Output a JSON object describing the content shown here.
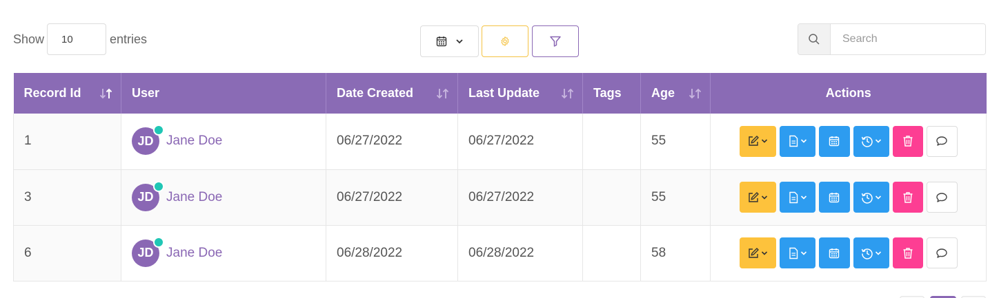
{
  "length_menu": {
    "show_label": "Show",
    "entries_label": "entries",
    "value": "10"
  },
  "toolbar": {
    "calendar_icon": "calendar-icon",
    "gear_icon": "gear-icon",
    "filter_icon": "filter-icon"
  },
  "search": {
    "placeholder": "Search",
    "value": ""
  },
  "table": {
    "columns": [
      {
        "label": "Record Id",
        "sortable": true,
        "sort": "desc-active"
      },
      {
        "label": "User",
        "sortable": false
      },
      {
        "label": "Date Created",
        "sortable": true
      },
      {
        "label": "Last Update",
        "sortable": true
      },
      {
        "label": "Tags",
        "sortable": false
      },
      {
        "label": "Age",
        "sortable": true
      },
      {
        "label": "Actions",
        "sortable": false
      }
    ],
    "rows": [
      {
        "id": "1",
        "initials": "JD",
        "user": "Jane Doe",
        "created": "06/27/2022",
        "updated": "06/27/2022",
        "tags": "",
        "age": "55"
      },
      {
        "id": "3",
        "initials": "JD",
        "user": "Jane Doe",
        "created": "06/27/2022",
        "updated": "06/27/2022",
        "tags": "",
        "age": "55"
      },
      {
        "id": "6",
        "initials": "JD",
        "user": "Jane Doe",
        "created": "06/28/2022",
        "updated": "06/28/2022",
        "tags": "",
        "age": "58"
      }
    ]
  },
  "colors": {
    "header_bg": "#8a6bb5",
    "edit": "#fdc23c",
    "primary": "#2d9cf0",
    "delete": "#fd3e93",
    "online": "#20c6b5"
  }
}
